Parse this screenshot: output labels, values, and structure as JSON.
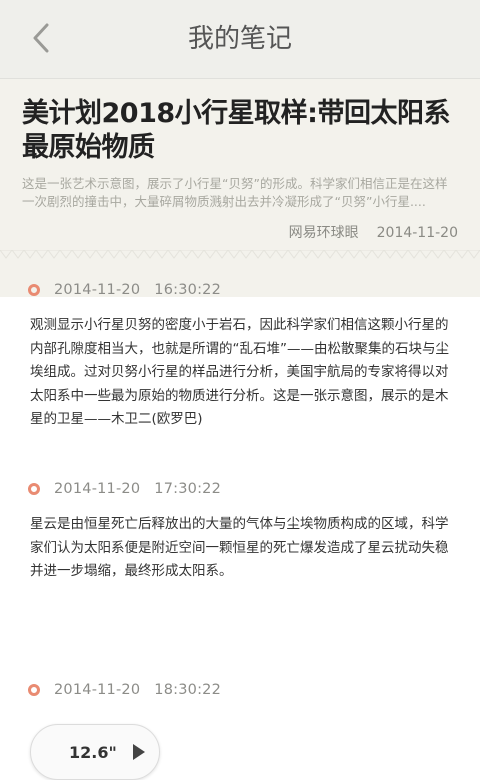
{
  "nav": {
    "title": "我的笔记",
    "back_icon": "chevron-left-icon"
  },
  "article": {
    "title": "美计划2018小行星取样:带回太阳系最原始物质",
    "summary": "这是一张艺术示意图，展示了小行星“贝努”的形成。科学家们相信正是在这样一次剧烈的撞击中，大量碎屑物质溅射出去并冷凝形成了“贝努”小行星....",
    "source": "网易环球眼",
    "date": "2014-11-20"
  },
  "notes": [
    {
      "date": "2014-11-20",
      "time": "16:30:22",
      "text": "观测显示小行星贝努的密度小于岩石，因此科学家们相信这颗小行星的内部孔隙度相当大，也就是所谓的“乱石堆”——由松散聚集的石块与尘埃组成。过对贝努小行星的样品进行分析，美国宇航局的专家将得以对太阳系中一些最为原始的物质进行分析。这是一张示意图，展示的是木星的卫星——木卫二(欧罗巴)"
    },
    {
      "date": "2014-11-20",
      "time": "17:30:22",
      "text": "星云是由恒星死亡后释放出的大量的气体与尘埃物质构成的区域，科学家们认为太阳系便是附近空间一颗恒星的死亡爆发造成了星云扰动失稳并进一步塌缩，最终形成太阳系。"
    },
    {
      "date": "2014-11-20",
      "time": "18:30:22",
      "audio_length": "12.6\"",
      "audio_icon": "play-icon"
    }
  ],
  "colors": {
    "nav_bg": "#efefeb",
    "header_bg": "#f3f2ec",
    "dot_accent": "#e98b72"
  }
}
